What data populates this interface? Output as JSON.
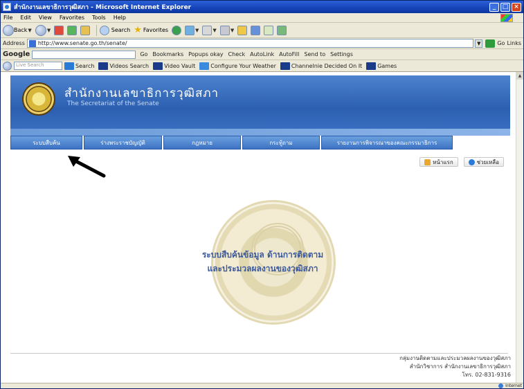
{
  "window": {
    "title": "สำนักงานเลขาธิการวุฒิสภา - Microsoft Internet Explorer",
    "controls": [
      "_",
      "□",
      "×"
    ]
  },
  "menu": [
    "File",
    "Edit",
    "View",
    "Favorites",
    "Tools",
    "Help"
  ],
  "toolbar": {
    "back": "Back",
    "search": "Search",
    "favorites": "Favorites"
  },
  "address": {
    "label": "Address",
    "url": "http://www.senate.go.th/senate/",
    "go": "Go",
    "links": "Links"
  },
  "google": {
    "logo": "Google",
    "items": [
      "Go",
      "Bookmarks",
      "Popups okay",
      "Check",
      "AutoLink",
      "AutoFill",
      "Send to",
      "Settings"
    ]
  },
  "live": {
    "search_placeholder": "Live Search",
    "items": [
      "Search",
      "Videos Search",
      "Video Vault",
      "Configure Your Weather",
      "Channelnie Decided On It",
      "Games"
    ]
  },
  "page": {
    "th_title": "สำนักงานเลขาธิการวุฒิสภา",
    "en_title": "The Secretariat of the Senate",
    "tabs": [
      "ระบบสืบค้น",
      "ร่างพระราชบัญญัติ",
      "กฎหมาย",
      "กระทู้ถาม",
      "รายงานการพิจารณาของคณะกรรมาธิการ"
    ],
    "btn_home": "หน้าแรก",
    "btn_help": "ช่วยเหลือ",
    "center_line1": "ระบบสืบค้นข้อมูล ด้านการติดตาม",
    "center_line2": "และประมวลผลงานของวุฒิสภา",
    "footer_line1": "กลุ่มงานติดตามและประมวลผลงานของวุฒิสภา",
    "footer_line2": "สำนักวิชาการ สำนักงานเลขาธิการวุฒิสภา",
    "footer_line3": "โทร. 02-831-9316"
  },
  "status": {
    "zone": "Internet"
  },
  "colors": {
    "banner": "#2c5fb0",
    "tab": "#4a82d0",
    "arrow": "#000000"
  }
}
